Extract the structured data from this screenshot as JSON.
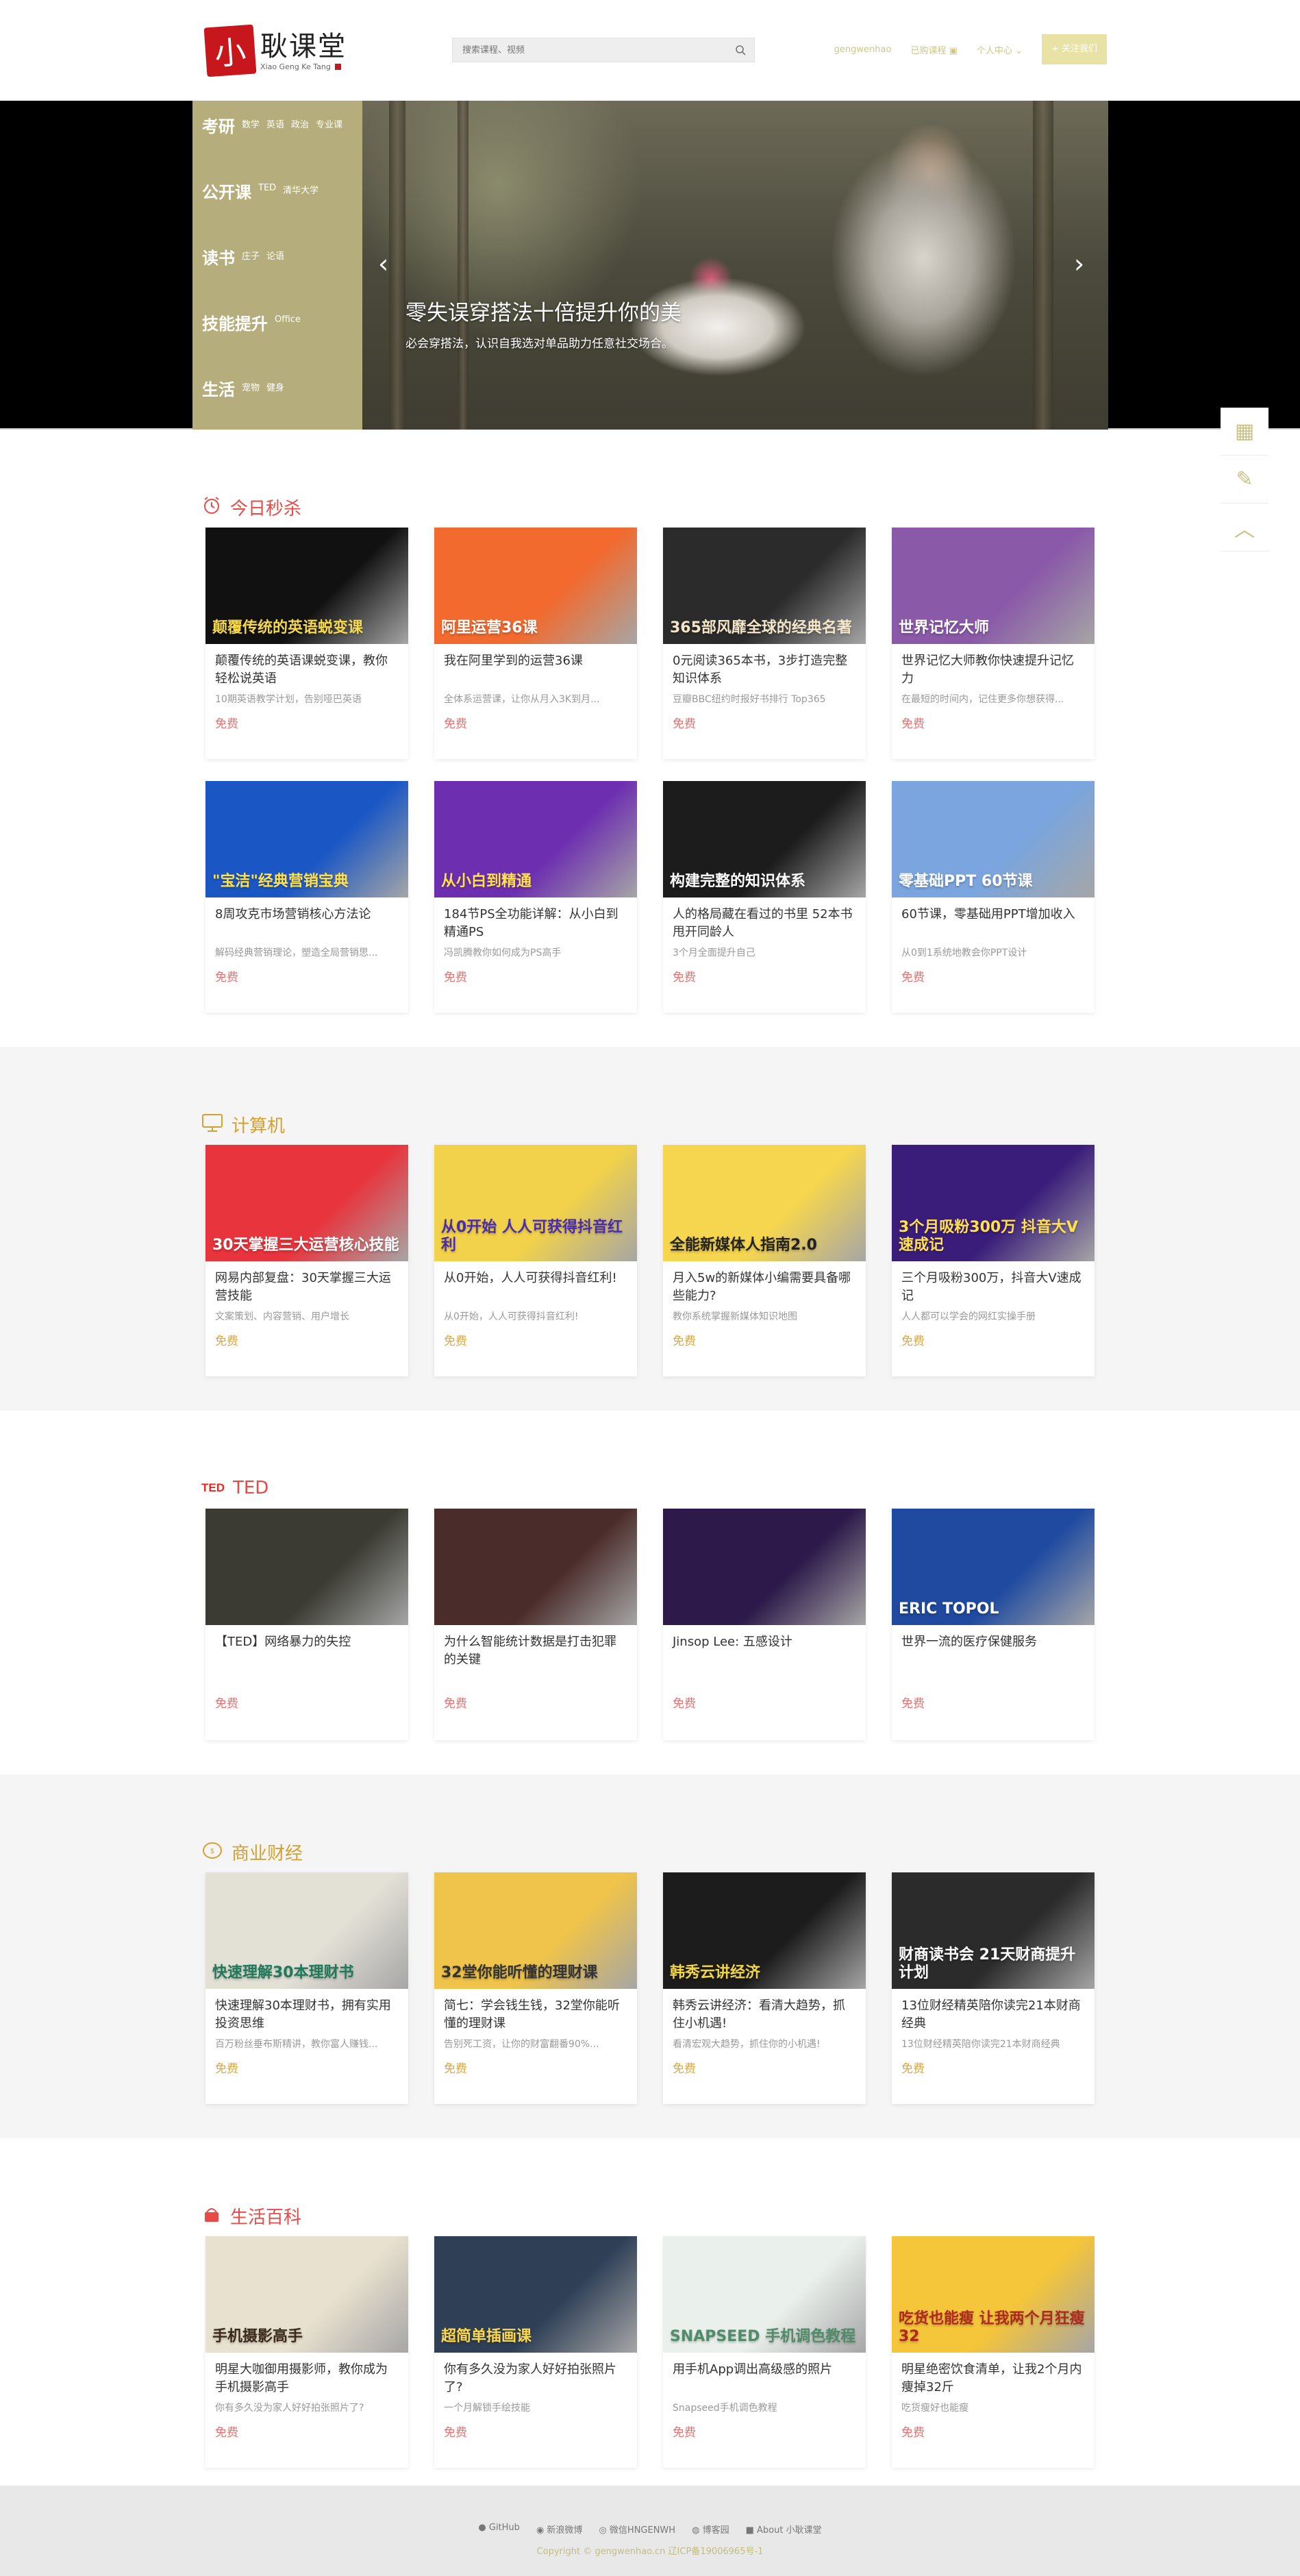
{
  "header": {
    "logo_char": "小",
    "logo_name": "耿课堂",
    "logo_en": "Xiao Geng Ke Tang",
    "search_placeholder": "搜索课程、视频",
    "user": "gengwenhao",
    "cart": "已购课程",
    "center": "个人中心",
    "cta": "+ 关注我们"
  },
  "menu": [
    {
      "title": "考研",
      "subs": [
        "数学",
        "英语",
        "政治",
        "专业课"
      ]
    },
    {
      "title": "公开课",
      "subs": [
        "TED",
        "清华大学"
      ]
    },
    {
      "title": "读书",
      "subs": [
        "庄子",
        "论语"
      ]
    },
    {
      "title": "技能提升",
      "subs": [
        "Office"
      ]
    },
    {
      "title": "生活",
      "subs": [
        "宠物",
        "健身"
      ]
    }
  ],
  "banner": {
    "title": "零失误穿搭法十倍提升你的美",
    "subtitle": "必会穿搭法，认识自我选对单品助力任意社交场合。",
    "prev": "‹",
    "next": "›"
  },
  "colors": {
    "accent": "#b5ad7c",
    "red": "#e84b47",
    "gold": "#d4a032"
  },
  "sections": [
    {
      "title": "今日秒杀",
      "icon": "alarm-clock-icon",
      "style": "red",
      "courses": [
        {
          "title": "颠覆传统的英语课蜕变课，教你轻松说英语",
          "desc": "10期英语教学计划，告别哑巴英语",
          "price": "免费",
          "thumb": "颠覆传统的英语蜕变课",
          "bg": "#111111",
          "fg": "#f5d84b"
        },
        {
          "title": "我在阿里学到的运营36课",
          "desc": "全体系运营课，让你从月入3K到月...",
          "price": "免费",
          "thumb": "阿里运营36课",
          "bg": "#f26a2e",
          "fg": "#ffffff"
        },
        {
          "title": "0元阅读365本书，3步打造完整知识体系",
          "desc": "豆瓣BBC纽约时报好书排行 Top365",
          "price": "免费",
          "thumb": "365部风靡全球的经典名著",
          "bg": "#2b2b2b",
          "fg": "#f3e6c8"
        },
        {
          "title": "世界记忆大师教你快速提升记忆力",
          "desc": "在最短的时间内，记住更多你想获得...",
          "price": "免费",
          "thumb": "世界记忆大师",
          "bg": "#8a5aa8",
          "fg": "#ffffff"
        },
        {
          "title": "8周攻克市场营销核心方法论",
          "desc": "解码经典营销理论，塑造全局营销思...",
          "price": "免费",
          "thumb": "\"宝洁\"经典营销宝典",
          "bg": "#1a56c4",
          "fg": "#ffe14d"
        },
        {
          "title": "184节PS全功能详解：从小白到精通PS",
          "desc": "冯凯腾教你如何成为PS高手",
          "price": "免费",
          "thumb": "从小白到精通",
          "bg": "#6d2fb0",
          "fg": "#ffe14d"
        },
        {
          "title": "人的格局藏在看过的书里 52本书甩开同龄人",
          "desc": "3个月全面提升自己",
          "price": "免费",
          "thumb": "构建完整的知识体系",
          "bg": "#1c1c1c",
          "fg": "#ffffff"
        },
        {
          "title": "60节课，零基础用PPT增加收入",
          "desc": "从0到1系统地教会你PPT设计",
          "price": "免费",
          "thumb": "零基础PPT 60节课",
          "bg": "#7aa5de",
          "fg": "#ffffff"
        }
      ]
    },
    {
      "title": "计算机",
      "icon": "monitor-icon",
      "style": "gold",
      "courses": [
        {
          "title": "网易内部复盘：30天掌握三大运营技能",
          "desc": "文案策划、内容营销、用户增长",
          "price": "免费",
          "thumb": "30天掌握三大运营核心技能",
          "bg": "#e8343c",
          "fg": "#ffffff"
        },
        {
          "title": "从0开始，人人可获得抖音红利!",
          "desc": "从0开始，人人可获得抖音红利!",
          "price": "免费",
          "thumb": "从0开始 人人可获得抖音红利",
          "bg": "#f2d24a",
          "fg": "#4a2bb0"
        },
        {
          "title": "月入5w的新媒体小编需要具备哪些能力?",
          "desc": "教你系统掌握新媒体知识地图",
          "price": "免费",
          "thumb": "全能新媒体人指南2.0",
          "bg": "#f6d64f",
          "fg": "#222222"
        },
        {
          "title": "三个月吸粉300万，抖音大V速成记",
          "desc": "人人都可以学会的网红实操手册",
          "price": "免费",
          "thumb": "3个月吸粉300万 抖音大V速成记",
          "bg": "#3a1d7a",
          "fg": "#ffe14d"
        }
      ]
    },
    {
      "title": "TED",
      "icon": "ted-logo-icon",
      "style": "red",
      "courses": [
        {
          "title": "【TED】网络暴力的失控",
          "desc": "",
          "price": "免费",
          "thumb": "",
          "bg": "#3b3b33",
          "fg": "#ffffff"
        },
        {
          "title": "为什么智能统计数据是打击犯罪的关键",
          "desc": "",
          "price": "免费",
          "thumb": "",
          "bg": "#4a2c2a",
          "fg": "#ffffff"
        },
        {
          "title": "Jinsop Lee: 五感设计",
          "desc": "",
          "price": "免费",
          "thumb": "",
          "bg": "#2d1a4a",
          "fg": "#ffffff"
        },
        {
          "title": "世界一流的医疗保健服务",
          "desc": "",
          "price": "免费",
          "thumb": "ERIC TOPOL",
          "bg": "#1f4aa0",
          "fg": "#ffffff"
        }
      ]
    },
    {
      "title": "商业财经",
      "icon": "coin-icon",
      "style": "gold",
      "courses": [
        {
          "title": "快速理解30本理财书，拥有实用投资思维",
          "desc": "百万粉丝垂布斯精讲，教你富人赚钱...",
          "price": "免费",
          "thumb": "快速理解30本理财书",
          "bg": "#e3e0d6",
          "fg": "#1e7a5a"
        },
        {
          "title": "简七：学会钱生钱，32堂你能听懂的理财课",
          "desc": "告别死工资，让你的财富翻番90%...",
          "price": "免费",
          "thumb": "32堂你能听懂的理财课",
          "bg": "#f0c44a",
          "fg": "#333333"
        },
        {
          "title": "韩秀云讲经济：看清大趋势，抓住小机遇!",
          "desc": "看清宏观大趋势，抓住你的小机遇!",
          "price": "免费",
          "thumb": "韩秀云讲经济",
          "bg": "#1c1c1c",
          "fg": "#f0d44a"
        },
        {
          "title": "13位财经精英陪你读完21本财商经典",
          "desc": "13位财经精英陪你读完21本财商经典",
          "price": "免费",
          "thumb": "财商读书会 21天财商提升计划",
          "bg": "#2b2b2b",
          "fg": "#ffffff"
        }
      ]
    },
    {
      "title": "生活百科",
      "icon": "gift-basket-icon",
      "style": "red",
      "courses": [
        {
          "title": "明星大咖御用摄影师，教你成为手机摄影高手",
          "desc": "你有多久没为家人好好拍张照片了?",
          "price": "免费",
          "thumb": "手机摄影高手",
          "bg": "#e9e1cf",
          "fg": "#3a2a1a"
        },
        {
          "title": "你有多久没为家人好好拍张照片了?",
          "desc": "一个月解锁手绘技能",
          "price": "免费",
          "thumb": "超简单插画课",
          "bg": "#2e3f56",
          "fg": "#ffd84a"
        },
        {
          "title": "用手机App调出高级感的照片",
          "desc": "Snapseed手机调色教程",
          "price": "免费",
          "thumb": "SNAPSEED 手机调色教程",
          "bg": "#eaf0ec",
          "fg": "#4f8c69"
        },
        {
          "title": "明星绝密饮食清单，让我2个月内痩掉32斤",
          "desc": "吃货瘦好也能瘦",
          "price": "免费",
          "thumb": "吃货也能瘦 让我两个月狂瘦32",
          "bg": "#f5c53a",
          "fg": "#b0281e"
        }
      ]
    }
  ],
  "side": [
    "qrcode-icon",
    "edit-pencil-icon",
    "back-to-top-icon"
  ],
  "footer": {
    "links": [
      "GitHub",
      "新浪微博",
      "微信HNGENWH",
      "博客园",
      "About 小耿课堂"
    ],
    "copyright": "Copyright © gengwenhao.cn  辽ICP备19006965号-1"
  }
}
